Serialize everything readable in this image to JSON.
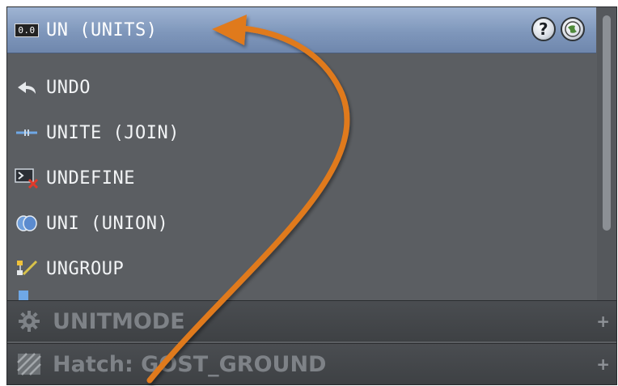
{
  "list": {
    "items": [
      {
        "label": "UN (UNITS)",
        "icon": "units-readout-icon",
        "selected": true
      },
      {
        "label": "UNDO",
        "icon": "undo-arrow-icon"
      },
      {
        "label": "UNITE (JOIN)",
        "icon": "join-icon"
      },
      {
        "label": "UNDEFINE",
        "icon": "undefine-icon"
      },
      {
        "label": "UNI (UNION)",
        "icon": "union-icon"
      },
      {
        "label": "UNGROUP",
        "icon": "ungroup-icon"
      }
    ],
    "units_icon_text": "0.0",
    "help_icon_text": "?"
  },
  "sections": [
    {
      "label": "UNITMODE",
      "icon": "gear-icon",
      "expand": "+"
    },
    {
      "label": "Hatch: GOST_GROUND",
      "icon": "hatch-pattern-icon",
      "expand": "+"
    }
  ],
  "colors": {
    "selected_row": "#7f97bb",
    "panel_bg": "#5b5e62",
    "annotation_arrow": "#e07a1f"
  }
}
